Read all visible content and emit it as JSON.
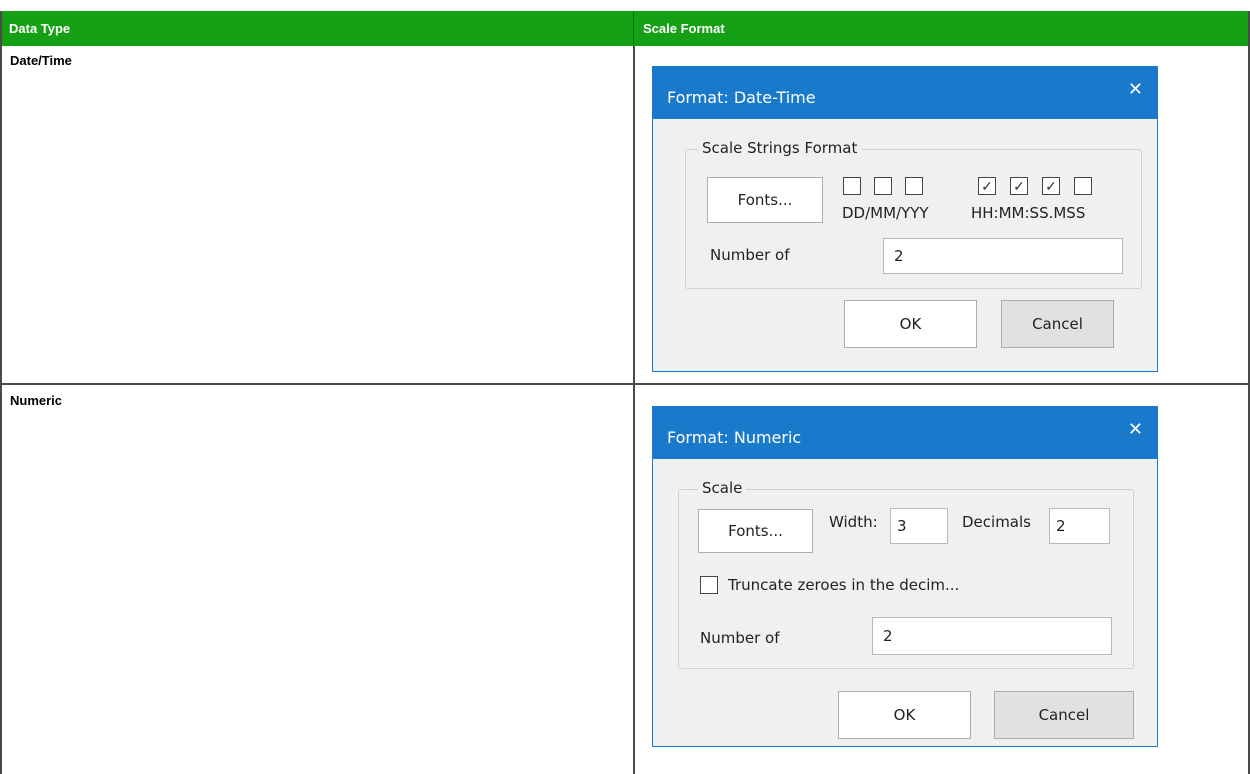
{
  "table": {
    "headers": [
      "Data Type",
      "Scale Format"
    ],
    "rows": [
      {
        "data_type": "Date/Time"
      },
      {
        "data_type": "Numeric"
      }
    ]
  },
  "datetime_dialog": {
    "title": "Format: Date-Time",
    "close_glyph": "✕",
    "group_caption": "Scale Strings Format",
    "fonts_label": "Fonts...",
    "checkboxes": [
      false,
      false,
      false,
      true,
      true,
      true,
      false
    ],
    "checked_glyph": "✓",
    "date_format_label": "DD/MM/YYY",
    "time_format_label": "HH:MM:SS.MSS",
    "number_of_label": "Number of",
    "number_of_value": "2",
    "ok_label": "OK",
    "cancel_label": "Cancel"
  },
  "numeric_dialog": {
    "title": "Format: Numeric",
    "close_glyph": "✕",
    "group_caption": "Scale",
    "fonts_label": "Fonts...",
    "width_label": "Width:",
    "width_value": "3",
    "decimals_label": "Decimals",
    "decimals_value": "2",
    "truncate_checked": false,
    "truncate_label": "Truncate zeroes in the decim...",
    "number_of_label": "Number of",
    "number_of_value": "2",
    "ok_label": "OK",
    "cancel_label": "Cancel"
  },
  "colors": {
    "header_green": "#15a015",
    "titlebar_blue": "#1979ca",
    "dialog_bg": "#f0f0f0"
  }
}
